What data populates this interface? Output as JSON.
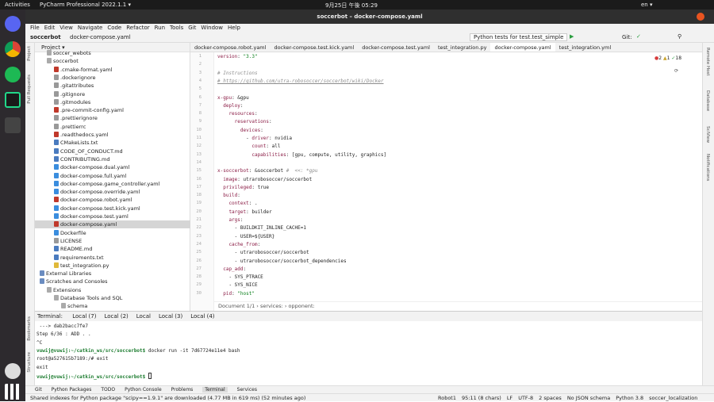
{
  "topbar": {
    "activities": "Activities",
    "app": "PyCharm Professional 2022.1.1 ▾",
    "clock": "9月25日 午後 05:29",
    "lang": "en ▾"
  },
  "window": {
    "title": "soccerbot – docker-compose.yaml"
  },
  "menu": [
    "File",
    "Edit",
    "View",
    "Navigate",
    "Code",
    "Refactor",
    "Run",
    "Tools",
    "Git",
    "Window",
    "Help"
  ],
  "nav": {
    "project": "soccerbot",
    "file": "docker-compose.yaml",
    "run_config": "Python tests for test.test_simple",
    "git_label": "Git:"
  },
  "tabs": [
    {
      "label": "docker-compose.robot.yaml",
      "active": false
    },
    {
      "label": "docker-compose.test.kick.yaml",
      "active": false
    },
    {
      "label": "docker-compose.test.yaml",
      "active": false
    },
    {
      "label": "test_integration.py",
      "active": false
    },
    {
      "label": "docker-compose.yaml",
      "active": true
    },
    {
      "label": "test_integration.yml",
      "active": false
    }
  ],
  "project": {
    "header": "Project ▾",
    "items": [
      {
        "label": "soccer_webots",
        "indent": 1,
        "type": "folder"
      },
      {
        "label": "soccerbot",
        "indent": 1,
        "type": "folder"
      },
      {
        "label": ".cmake-format.yaml",
        "indent": 2,
        "type": "yaml"
      },
      {
        "label": ".dockerignore",
        "indent": 2,
        "type": "file"
      },
      {
        "label": ".gitattributes",
        "indent": 2,
        "type": "file"
      },
      {
        "label": ".gitignore",
        "indent": 2,
        "type": "file"
      },
      {
        "label": ".gitmodules",
        "indent": 2,
        "type": "file"
      },
      {
        "label": ".pre-commit-config.yaml",
        "indent": 2,
        "type": "yaml"
      },
      {
        "label": ".prettierignore",
        "indent": 2,
        "type": "file"
      },
      {
        "label": ".prettierrc",
        "indent": 2,
        "type": "file"
      },
      {
        "label": ".readthedocs.yaml",
        "indent": 2,
        "type": "yaml"
      },
      {
        "label": "CMakeLists.txt",
        "indent": 2,
        "type": "txt"
      },
      {
        "label": "CODE_OF_CONDUCT.md",
        "indent": 2,
        "type": "md"
      },
      {
        "label": "CONTRIBUTING.md",
        "indent": 2,
        "type": "md"
      },
      {
        "label": "docker-compose.dual.yaml",
        "indent": 2,
        "type": "docker"
      },
      {
        "label": "docker-compose.full.yaml",
        "indent": 2,
        "type": "docker"
      },
      {
        "label": "docker-compose.game_controller.yaml",
        "indent": 2,
        "type": "docker"
      },
      {
        "label": "docker-compose.override.yaml",
        "indent": 2,
        "type": "docker"
      },
      {
        "label": "docker-compose.robot.yaml",
        "indent": 2,
        "type": "yaml"
      },
      {
        "label": "docker-compose.test.kick.yaml",
        "indent": 2,
        "type": "docker"
      },
      {
        "label": "docker-compose.test.yaml",
        "indent": 2,
        "type": "docker"
      },
      {
        "label": "docker-compose.yaml",
        "indent": 2,
        "type": "yaml",
        "selected": true
      },
      {
        "label": "Dockerfile",
        "indent": 2,
        "type": "docker"
      },
      {
        "label": "LICENSE",
        "indent": 2,
        "type": "file"
      },
      {
        "label": "README.md",
        "indent": 2,
        "type": "md"
      },
      {
        "label": "requirements.txt",
        "indent": 2,
        "type": "txt"
      },
      {
        "label": "test_integration.py",
        "indent": 2,
        "type": "py"
      },
      {
        "label": "External Libraries",
        "indent": 0,
        "type": "lib"
      },
      {
        "label": "Scratches and Consoles",
        "indent": 0,
        "type": "lib"
      },
      {
        "label": "Extensions",
        "indent": 1,
        "type": "folder"
      },
      {
        "label": "Database Tools and SQL",
        "indent": 2,
        "type": "folder"
      },
      {
        "label": "schema",
        "indent": 3,
        "type": "folder"
      }
    ]
  },
  "editor": {
    "inspections": {
      "errors": "2",
      "warnings": "1",
      "ok": "18"
    },
    "lines": [
      [
        [
          "k",
          "version"
        ],
        [
          "p",
          ": "
        ],
        [
          "s",
          "\"3.3\""
        ]
      ],
      [],
      [
        [
          "c",
          "# Instructions"
        ]
      ],
      [
        [
          "u",
          "# https://github.com/utra-robosoccer/soccerbot/wiki/Docker"
        ]
      ],
      [],
      [
        [
          "k",
          "x-gpu"
        ],
        [
          "p",
          ": &gpu"
        ]
      ],
      [
        [
          "k",
          "  deploy"
        ],
        [
          "p",
          ":"
        ]
      ],
      [
        [
          "k",
          "    resources"
        ],
        [
          "p",
          ":"
        ]
      ],
      [
        [
          "k",
          "      reservations"
        ],
        [
          "p",
          ":"
        ]
      ],
      [
        [
          "k",
          "        devices"
        ],
        [
          "p",
          ":"
        ]
      ],
      [
        [
          "p",
          "          - "
        ],
        [
          "k",
          "driver"
        ],
        [
          "p",
          ": nvidia"
        ]
      ],
      [
        [
          "k",
          "            count"
        ],
        [
          "p",
          ": all"
        ]
      ],
      [
        [
          "k",
          "            capabilities"
        ],
        [
          "p",
          ": [gpu, compute, utility, graphics]"
        ]
      ],
      [],
      [
        [
          "k",
          "x-soccerbot"
        ],
        [
          "p",
          ": &soccerbot "
        ],
        [
          "c",
          "#  <<: *gpu"
        ]
      ],
      [
        [
          "k",
          "  image"
        ],
        [
          "p",
          ": utrarobosoccer/soccerbot"
        ]
      ],
      [
        [
          "k",
          "  privileged"
        ],
        [
          "p",
          ": true"
        ]
      ],
      [
        [
          "k",
          "  build"
        ],
        [
          "p",
          ":"
        ]
      ],
      [
        [
          "k",
          "    context"
        ],
        [
          "p",
          ": ."
        ]
      ],
      [
        [
          "k",
          "    target"
        ],
        [
          "p",
          ": builder"
        ]
      ],
      [
        [
          "k",
          "    args"
        ],
        [
          "p",
          ":"
        ]
      ],
      [
        [
          "p",
          "      - BUILDKIT_INLINE_CACHE=1"
        ]
      ],
      [
        [
          "p",
          "      - USER=${USER}"
        ]
      ],
      [
        [
          "k",
          "    cache_from"
        ],
        [
          "p",
          ":"
        ]
      ],
      [
        [
          "p",
          "      - utrarobosoccer/soccerbot"
        ]
      ],
      [
        [
          "p",
          "      - utrarobosoccer/soccerbot_dependencies"
        ]
      ],
      [
        [
          "k",
          "  cap_add"
        ],
        [
          "p",
          ":"
        ]
      ],
      [
        [
          "p",
          "    - SYS_PTRACE"
        ]
      ],
      [
        [
          "p",
          "    - SYS_NICE"
        ]
      ],
      [
        [
          "k",
          "  pid"
        ],
        [
          "p",
          ": "
        ],
        [
          "s",
          "\"host\""
        ]
      ]
    ],
    "breadcrumb": [
      "Document 1/1",
      "services:",
      "opponent:"
    ]
  },
  "right_strip": [
    "Remote Host",
    "Database",
    "SciView",
    "Notifications"
  ],
  "left_strip": [
    "Project",
    "Pull Requests",
    "Bookmarks",
    "Structure"
  ],
  "terminal": {
    "label": "Terminal:",
    "tabs": [
      "Local (7)",
      "Local (2)",
      "Local",
      "Local (3)",
      "Local (4)"
    ],
    "lines": [
      {
        "text": " ---> dab2bacc7fe7"
      },
      {
        "text": "Step 6/36 : ADD . ."
      },
      {
        "text": "^C"
      },
      {
        "prompt": "vuwij@vuwij:~/catkin_ws/src/soccerbot$",
        "text": " docker run -it 7d67724e11e4 bash"
      },
      {
        "text": "root@a527615b7189:/# exit"
      },
      {
        "text": "exit"
      },
      {
        "prompt": "vuwij@vuwij:~/catkin_ws/src/soccerbot$",
        "text": " "
      }
    ]
  },
  "toolwindows": [
    "Git",
    "Python Packages",
    "TODO",
    "Python Console",
    "Problems",
    "Terminal",
    "Services"
  ],
  "status": {
    "message": "Shared indexes for Python package \"scipy==1.9.1\" are downloaded (4.77 MB in 619 ms) (52 minutes ago)",
    "items": [
      "Robot1",
      "95:11 (8 chars)",
      "LF",
      "UTF-8",
      "2 spaces",
      "No JSON schema",
      "Python 3.8",
      "soccer_localization"
    ]
  },
  "colors": {
    "accent": "#4083c9",
    "keyword": "#8a1c45",
    "string": "#067d17"
  }
}
